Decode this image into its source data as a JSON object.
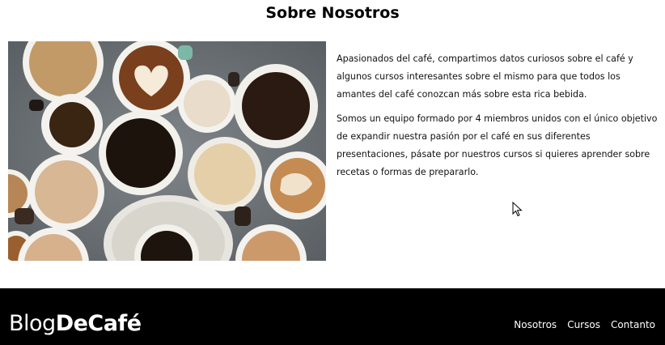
{
  "about": {
    "title": "Sobre Nosotros",
    "image_alt": "Tazas de café vistas desde arriba",
    "paragraphs": [
      "Apasionados del café, compartimos datos curiosos sobre el café y algunos cursos interesantes sobre el mismo para que todos los amantes del café conozcan más sobre esta rica bebida.",
      "Somos un equipo formado por 4 miembros unidos con el único objetivo de expandir nuestra pasión por el café en sus diferentes presentaciones, pásate por nuestros cursos si quieres aprender sobre recetas o formas de prepararlo."
    ]
  },
  "footer": {
    "logo_light": "Blog",
    "logo_bold": "DeCafé",
    "nav": [
      {
        "label": "Nosotros"
      },
      {
        "label": "Cursos"
      },
      {
        "label": "Contanto"
      }
    ]
  },
  "colors": {
    "footer_bg": "#000000",
    "page_bg": "#ffffff",
    "table_surface": "#6f7478"
  }
}
